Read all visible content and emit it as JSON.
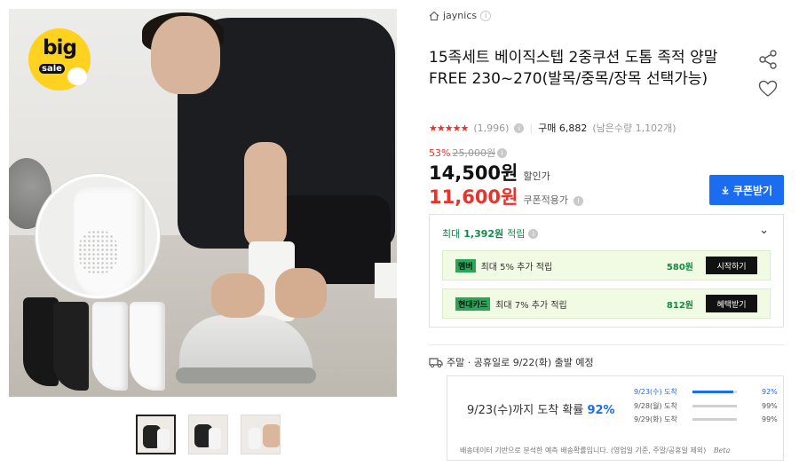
{
  "badge": {
    "big": "big",
    "sale": "sale"
  },
  "seller": {
    "name": "jaynics",
    "info": "i"
  },
  "product": {
    "title": "15족세트 베이직스텝 2중쿠션 도톰 족적 양말 FREE 230~270(발목/중목/장목 선택가능)"
  },
  "rating": {
    "stars": "★★★★★",
    "count": "(1,996)",
    "buy_label": "구매 6,882",
    "remaining": "(남은수량 1,102개)"
  },
  "price": {
    "discount_pct": "53%",
    "original": "25,000원",
    "sale": "14,500원",
    "sale_label": "할인가",
    "coupon": "11,600원",
    "coupon_label": "쿠폰적용가"
  },
  "coupon_button": "쿠폰받기",
  "reward": {
    "max_prefix": "최대",
    "max_amount": "1,392원",
    "max_suffix": "적립",
    "rows": [
      {
        "tag": "멤버",
        "text": "최대 5% 추가 적립",
        "amount": "580원",
        "button": "시작하기"
      },
      {
        "tag": "현대카드",
        "text": "최대 7% 추가 적립",
        "amount": "812원",
        "button": "혜택받기"
      }
    ]
  },
  "shipping": {
    "header": "주말 · 공휴일로 9/22(화) 출발 예정",
    "main_text": "9/23(수)까지 도착 확률",
    "main_pct": "92%",
    "probs": [
      {
        "date": "9/23(수) 도착",
        "pct": "92%",
        "fill": 0.92
      },
      {
        "date": "9/28(월) 도착",
        "pct": "99%",
        "fill": 0.99
      },
      {
        "date": "9/29(화) 도착",
        "pct": "99%",
        "fill": 0.99
      }
    ],
    "note": "배송데이터 기반으로 분석한 예측 배송확률입니다. (영업일 기준, 주말/공휴일 제외)",
    "beta": "Beta"
  },
  "colors": {
    "accent": "#1a6cf0",
    "sale_red": "#e8332c",
    "reward_green": "#0f8a4a"
  }
}
